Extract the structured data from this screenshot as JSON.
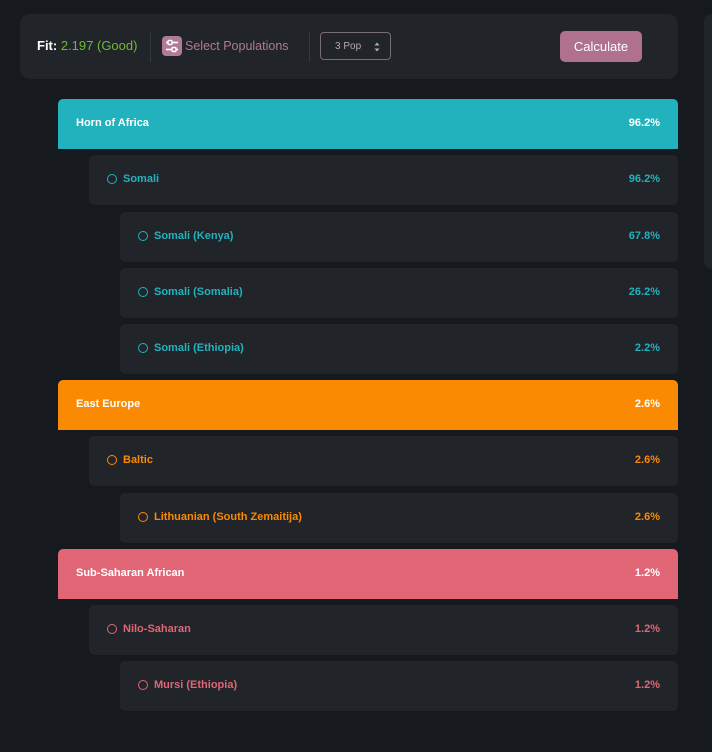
{
  "toolbar": {
    "fit_label": "Fit:",
    "fit_value": "2.197 (Good)",
    "select_label": "Select Populations",
    "pop_select_value": "3 Pop",
    "calculate_label": "Calculate"
  },
  "colors": {
    "horn": "#22b2be",
    "east_europe": "#fb8a03",
    "sub_saharan": "#e06676",
    "fit_value": "#6dbb3a",
    "accent": "#b0718f"
  },
  "regions": [
    {
      "label": "Horn of Africa",
      "pct": "96.2%",
      "groups": [
        {
          "label": "Somali",
          "pct": "96.2%",
          "items": [
            {
              "label": "Somali (Kenya)",
              "pct": "67.8%"
            },
            {
              "label": "Somali (Somalia)",
              "pct": "26.2%"
            },
            {
              "label": "Somali (Ethiopia)",
              "pct": "2.2%"
            }
          ]
        }
      ]
    },
    {
      "label": "East Europe",
      "pct": "2.6%",
      "groups": [
        {
          "label": "Baltic",
          "pct": "2.6%",
          "items": [
            {
              "label": "Lithuanian (South Zemaitija)",
              "pct": "2.6%"
            }
          ]
        }
      ]
    },
    {
      "label": "Sub-Saharan African",
      "pct": "1.2%",
      "groups": [
        {
          "label": "Nilo-Saharan",
          "pct": "1.2%",
          "items": [
            {
              "label": "Mursi (Ethiopia)",
              "pct": "1.2%"
            }
          ]
        }
      ]
    }
  ]
}
